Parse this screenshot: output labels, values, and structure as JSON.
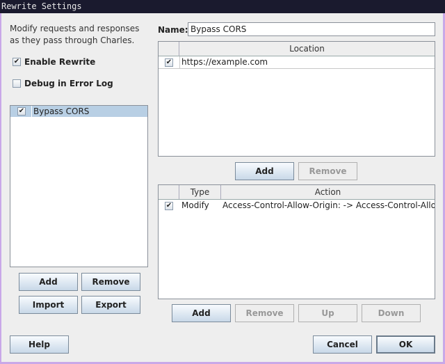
{
  "window": {
    "title": "Rewrite Settings"
  },
  "left": {
    "description": "Modify requests and responses as they pass through Charles.",
    "enable_rewrite": {
      "label": "Enable Rewrite",
      "checked": true
    },
    "debug_log": {
      "label": "Debug in Error Log",
      "checked": false
    },
    "rules": [
      {
        "name": "Bypass CORS",
        "checked": true,
        "selected": true
      }
    ],
    "buttons": {
      "add": "Add",
      "remove": "Remove",
      "import": "Import",
      "export": "Export"
    }
  },
  "right": {
    "name_label": "Name:",
    "name_value": "Bypass CORS",
    "locations": {
      "header": "Location",
      "rows": [
        {
          "checked": true,
          "location": "https://example.com"
        }
      ],
      "buttons": {
        "add": "Add",
        "remove": "Remove"
      }
    },
    "actions": {
      "headers": {
        "type": "Type",
        "action": "Action"
      },
      "rows": [
        {
          "checked": true,
          "type": "Modify",
          "action": "Access-Control-Allow-Origin: -> Access-Control-Allow..."
        }
      ],
      "buttons": {
        "add": "Add",
        "remove": "Remove",
        "up": "Up",
        "down": "Down"
      }
    }
  },
  "footer": {
    "help": "Help",
    "cancel": "Cancel",
    "ok": "OK"
  },
  "check_glyph": "✔"
}
